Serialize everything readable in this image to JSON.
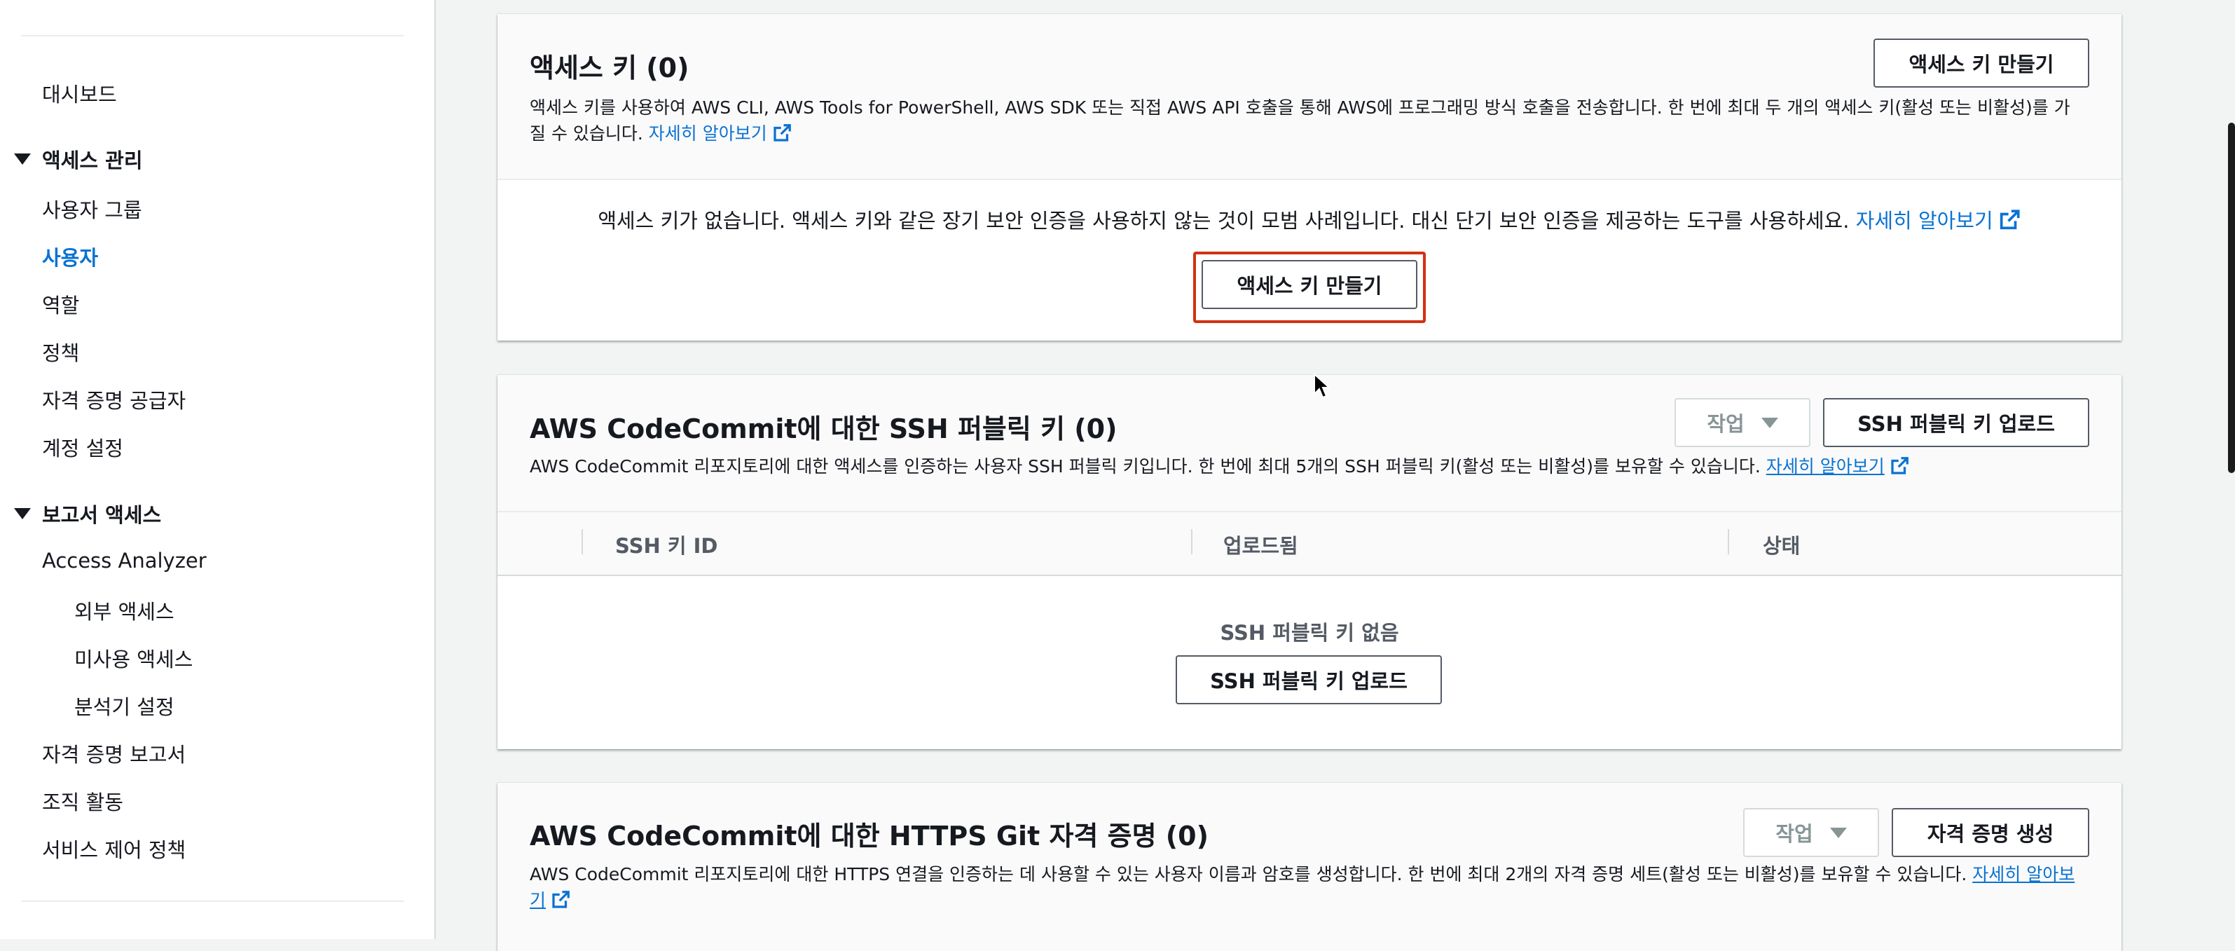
{
  "sidebar": {
    "items": [
      {
        "label": "대시보드"
      },
      {
        "label": "사용자 그룹"
      },
      {
        "label": "사용자"
      },
      {
        "label": "역할"
      },
      {
        "label": "정책"
      },
      {
        "label": "자격 증명 공급자"
      },
      {
        "label": "계정 설정"
      },
      {
        "label": "Access Analyzer"
      },
      {
        "label": "외부 액세스"
      },
      {
        "label": "미사용 액세스"
      },
      {
        "label": "분석기 설정"
      },
      {
        "label": "자격 증명 보고서"
      },
      {
        "label": "조직 활동"
      },
      {
        "label": "서비스 제어 정책"
      }
    ],
    "sections": [
      {
        "label": "액세스 관리"
      },
      {
        "label": "보고서 액세스"
      }
    ],
    "active_item": "사용자"
  },
  "access_keys": {
    "title": "액세스 키 (0)",
    "create_button": "액세스 키 만들기",
    "desc_line1": "액세스 키를 사용하여 AWS CLI, AWS Tools for PowerShell, AWS SDK 또는 직접 AWS API 호출을 통해 AWS에 프로그래밍 방식 호출을 전송합니다. 한 번에 최대 두 개의 액세스 키(활성 또는 비활성)를 가",
    "desc_line2": "질 수 있습니다.",
    "learn_more": "자세히 알아보기",
    "empty_message": "액세스 키가 없습니다. 액세스 키와 같은 장기 보안 인증을 사용하지 않는 것이 모범 사례입니다. 대신 단기 보안 인증을 제공하는 도구를 사용하세요.",
    "empty_learn_more": "자세히 알아보기",
    "empty_create_button": "액세스 키 만들기"
  },
  "ssh_keys": {
    "title": "AWS CodeCommit에 대한 SSH 퍼블릭 키 (0)",
    "actions_button": "작업",
    "upload_button": "SSH 퍼블릭 키 업로드",
    "desc": "AWS CodeCommit 리포지토리에 대한 액세스를 인증하는 사용자 SSH 퍼블릭 키입니다. 한 번에 최대 5개의 SSH 퍼블릭 키(활성 또는 비활성)를 보유할 수 있습니다.",
    "learn_more": "자세히 알아보기",
    "columns": [
      "SSH 키 ID",
      "업로드됨",
      "상태"
    ],
    "empty_text": "SSH 퍼블릭 키 없음",
    "empty_upload_button": "SSH 퍼블릭 키 업로드"
  },
  "https_git": {
    "title": "AWS CodeCommit에 대한 HTTPS Git 자격 증명 (0)",
    "actions_button": "작업",
    "generate_button": "자격 증명 생성",
    "desc": "AWS CodeCommit 리포지토리에 대한 HTTPS 연결을 인증하는 데 사용할 수 있는 사용자 이름과 암호를 생성합니다. 한 번에 최대 2개의 자격 증명 세트(활성 또는 비활성)를 보유할 수 있습니다.",
    "learn_more_part1": "자세히 알아보",
    "learn_more_part2": "기"
  },
  "colors": {
    "link": "#0972d3",
    "highlight": "#d13212",
    "background": "#f2f3f3"
  }
}
